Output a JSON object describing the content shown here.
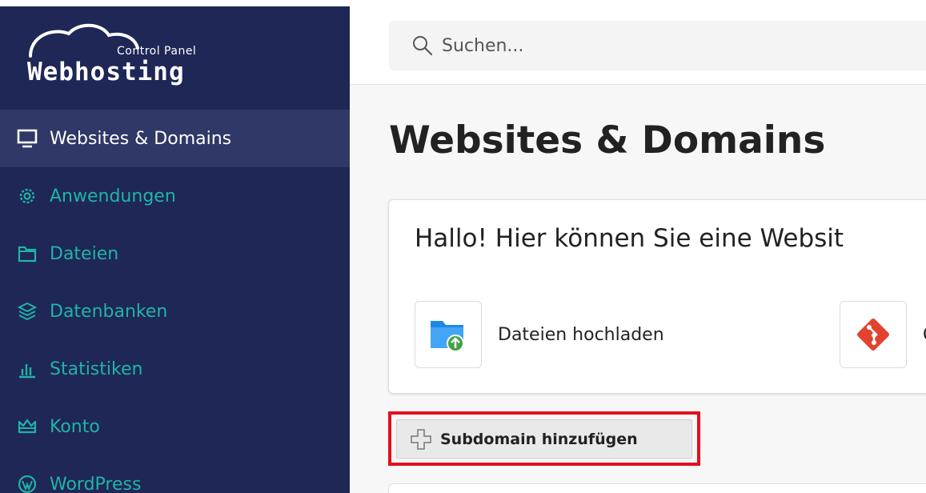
{
  "app": {
    "logo_small": "Control Panel",
    "logo_big": "Webhosting"
  },
  "search": {
    "placeholder": "Suchen...",
    "icon": "search-icon"
  },
  "sidebar": {
    "items": [
      {
        "label": "Websites & Domains",
        "icon": "monitor-icon",
        "active": true
      },
      {
        "label": "Anwendungen",
        "icon": "gear-icon",
        "active": false
      },
      {
        "label": "Dateien",
        "icon": "folder-icon",
        "active": false
      },
      {
        "label": "Datenbanken",
        "icon": "layers-icon",
        "active": false
      },
      {
        "label": "Statistiken",
        "icon": "bar-chart-icon",
        "active": false
      },
      {
        "label": "Konto",
        "icon": "crown-icon",
        "active": false
      },
      {
        "label": "WordPress",
        "icon": "wordpress-icon",
        "active": false
      }
    ]
  },
  "main": {
    "title": "Websites & Domains",
    "card": {
      "title": "Hallo! Hier können Sie eine Websit",
      "actions": [
        {
          "label": "Dateien hochladen",
          "icon": "folder-upload-icon"
        },
        {
          "label": "G",
          "icon": "git-icon"
        }
      ]
    },
    "subdomain_button": "Subdomain hinzufügen"
  },
  "colors": {
    "sidebar_bg": "#1e2756",
    "sidebar_active": "#2f3866",
    "nav_accent": "#21b3a8",
    "highlight": "#e3101c",
    "git_red": "#e2432e",
    "folder_blue": "#1e88e5",
    "upload_green": "#43a047"
  }
}
